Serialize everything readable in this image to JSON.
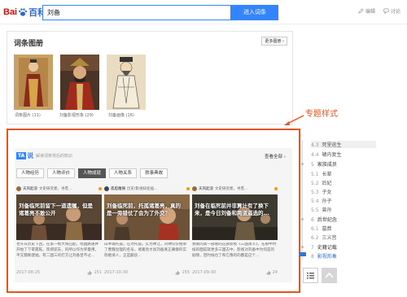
{
  "header": {
    "logo": {
      "part1": "Bai",
      "part2": "百科"
    },
    "search_value": "刘备",
    "search_button": "进入词条",
    "actions": [
      "编辑",
      "讨论"
    ]
  },
  "gallery": {
    "title": "词条图册",
    "more_label": "更多图册 ›",
    "items": [
      {
        "caption": "词条图片 (11)"
      },
      {
        "caption": "刘备影视形象 (29)"
      },
      {
        "caption": "刘备画像 (16)"
      }
    ]
  },
  "annotation": {
    "label": "专题样式"
  },
  "ta_panel": {
    "logo_ta": "TA",
    "logo_shuo": "说",
    "description": "解读词条背后的知识",
    "view_all": "查看全部 ›",
    "tabs": [
      {
        "label": "人物经历",
        "active": false
      },
      {
        "label": "人物评价",
        "active": false
      },
      {
        "label": "人物成就",
        "active": true
      },
      {
        "label": "人物关系",
        "active": false
      },
      {
        "label": "轶事典故",
        "active": false
      }
    ],
    "cards": [
      {
        "author": "天风起浪",
        "meta": "文史研究者，寻觅...",
        "image_title": "刘备临死前留下一道遗嘱，但是诸葛亮不敢公开",
        "excerpt": "也许从历史下回，在第一帧大将匹配，暗国路速并开始了下辈孤陈。宾郑逆去，的所以作为罗曼用，平又都奏建福，有二国三的打方让刘备曾不过...",
        "date": "2017-08-25",
        "likes": "151"
      },
      {
        "author": "孤胆雕镝",
        "meta": "历史/影视知名插...",
        "image_title": "刘备临死前，托孤诸葛亮，真的是一旁错仗了会为了外交？",
        "excerpt": "白帝城托孤，在为托孤，实为禅让，刘禅仅仅继承了曹魏治理的名号，诸葛亮才具刘备真正幕僚的实际继承人，正是蒯良...",
        "date": "2017-10-30",
        "likes": "155"
      },
      {
        "author": "天风起浪",
        "meta": "文史研究者，寻觅...",
        "image_title": "刘备在临死前并非算计有了换下来，是今日刘备和两道遥选的...",
        "excerpt": "我看的第一部看的这部影视《三国演义》，在那中时候的面前就更多三国志中，影视对刘备中为何是的剧情，回时候也了和它像的的都是这个...",
        "date": "2017-09-30",
        "likes": "24"
      }
    ]
  },
  "toc": {
    "items": [
      {
        "num": "4.3",
        "label": "死里逃生",
        "level": "sub",
        "current": true
      },
      {
        "num": "4.4",
        "label": "辕内复生",
        "level": "sub",
        "current": false
      },
      {
        "num": "5",
        "label": "家族成员",
        "level": "top",
        "current": false
      },
      {
        "num": "5.1",
        "label": "长辈",
        "level": "sub",
        "current": false
      },
      {
        "num": "5.2",
        "label": "后妃",
        "level": "sub",
        "current": false
      },
      {
        "num": "5.3",
        "label": "子女",
        "level": "sub",
        "current": false
      },
      {
        "num": "5.4",
        "label": "孙子",
        "level": "sub",
        "current": false
      },
      {
        "num": "5.5",
        "label": "曾孙",
        "level": "sub",
        "current": false
      },
      {
        "num": "6",
        "label": "后世纪念",
        "level": "top",
        "current": false
      },
      {
        "num": "6.1",
        "label": "墓葬",
        "level": "sub",
        "current": false
      },
      {
        "num": "6.2",
        "label": "三义宫",
        "level": "sub",
        "current": false
      },
      {
        "num": "7",
        "label": "史籍记载",
        "level": "top",
        "current": false
      },
      {
        "num": "8",
        "label": "影视形象",
        "level": "top",
        "current": false
      }
    ]
  },
  "colors": {
    "accent": "#3385ff",
    "highlight_border": "#e8541e",
    "brand_red": "#e10601"
  }
}
